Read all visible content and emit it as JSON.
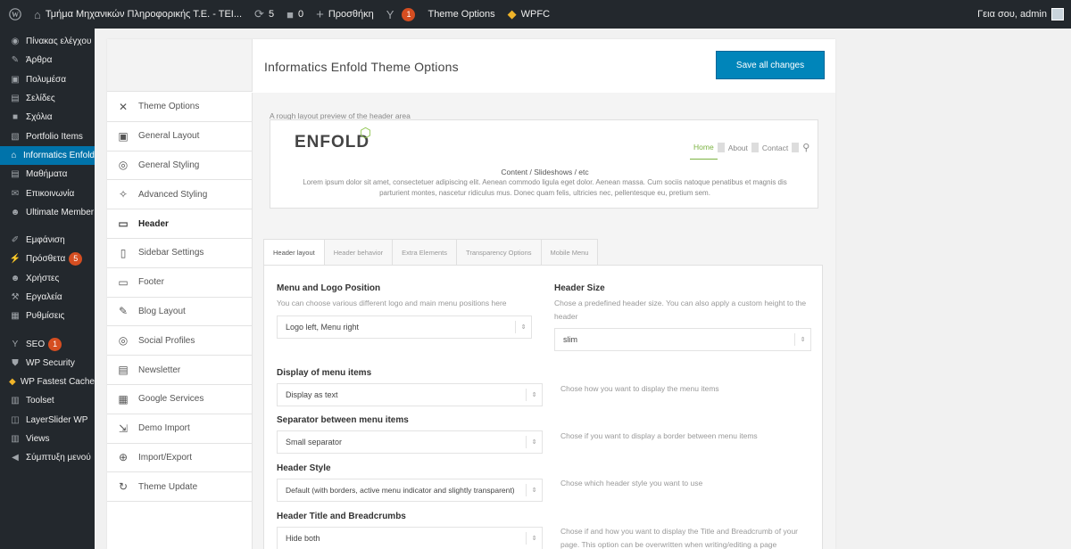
{
  "admin_bar": {
    "site_name": "Τμήμα Μηχανικών Πληροφορικής Τ.Ε. - ΤΕΙ...",
    "updates_count": "5",
    "comments_count": "0",
    "new_label": "Προσθήκη",
    "yoast_badge": "1",
    "theme_options_label": "Theme Options",
    "wpfc_label": "WPFC",
    "greeting": "Γεια σου, admin"
  },
  "sidebar": {
    "items": [
      {
        "label": "Πίνακας ελέγχου",
        "icon": "dashboard-icon"
      },
      {
        "label": "Άρθρα",
        "icon": "pin-icon"
      },
      {
        "label": "Πολυμέσα",
        "icon": "media-icon"
      },
      {
        "label": "Σελίδες",
        "icon": "page-icon"
      },
      {
        "label": "Σχόλια",
        "icon": "comment-icon"
      },
      {
        "label": "Portfolio Items",
        "icon": "portfolio-icon"
      },
      {
        "label": "Informatics Enfold",
        "icon": "home-icon"
      },
      {
        "label": "Μαθήματα",
        "icon": "page-icon"
      },
      {
        "label": "Επικοινωνία",
        "icon": "mail-icon"
      },
      {
        "label": "Ultimate Member",
        "icon": "user-icon"
      },
      {
        "label": "Εμφάνιση",
        "icon": "brush-icon"
      },
      {
        "label": "Πρόσθετα",
        "icon": "plugin-icon",
        "badge": "5"
      },
      {
        "label": "Χρήστες",
        "icon": "user-icon"
      },
      {
        "label": "Εργαλεία",
        "icon": "wrench-icon"
      },
      {
        "label": "Ρυθμίσεις",
        "icon": "settings-icon"
      },
      {
        "label": "SEO",
        "icon": "yoast-icon",
        "badge": "1"
      },
      {
        "label": "WP Security",
        "icon": "shield-icon"
      },
      {
        "label": "WP Fastest Cache",
        "icon": "cheetah-icon"
      },
      {
        "label": "Toolset",
        "icon": "toolset-icon"
      },
      {
        "label": "LayerSlider WP",
        "icon": "layers-icon"
      },
      {
        "label": "Views",
        "icon": "views-icon"
      },
      {
        "label": "Σύμπτυξη μενού",
        "icon": "collapse-icon"
      }
    ]
  },
  "page": {
    "title": "Informatics Enfold Theme Options",
    "save_label": "Save all changes"
  },
  "options_nav": [
    {
      "label": "Theme Options",
      "icon": "tools-icon"
    },
    {
      "label": "General Layout",
      "icon": "layout-icon"
    },
    {
      "label": "General Styling",
      "icon": "palette-icon"
    },
    {
      "label": "Advanced Styling",
      "icon": "magic-wand-icon"
    },
    {
      "label": "Header",
      "icon": "header-icon"
    },
    {
      "label": "Sidebar Settings",
      "icon": "sidebar-icon"
    },
    {
      "label": "Footer",
      "icon": "footer-icon"
    },
    {
      "label": "Blog Layout",
      "icon": "edit-icon"
    },
    {
      "label": "Social Profiles",
      "icon": "social-icon"
    },
    {
      "label": "Newsletter",
      "icon": "newsletter-icon"
    },
    {
      "label": "Google Services",
      "icon": "map-icon"
    },
    {
      "label": "Demo Import",
      "icon": "import-icon"
    },
    {
      "label": "Import/Export",
      "icon": "export-icon"
    },
    {
      "label": "Theme Update",
      "icon": "refresh-icon"
    }
  ],
  "preview": {
    "caption": "A rough layout preview of the header area",
    "logo": "ENFOLD",
    "menu": [
      "Home",
      "About",
      "Contact"
    ],
    "content_title": "Content / Slideshows / etc",
    "content_text": "Lorem ipsum dolor sit amet, consectetuer adipiscing elit. Aenean commodo ligula eget dolor. Aenean massa. Cum sociis natoque penatibus et magnis dis parturient montes, nascetur ridiculus mus. Donec quam felis, ultricies nec, pellentesque eu, pretium sem."
  },
  "tabs": [
    "Header layout",
    "Header behavior",
    "Extra Elements",
    "Transparency Options",
    "Mobile Menu"
  ],
  "fields": {
    "menu_logo": {
      "title": "Menu and Logo Position",
      "desc": "You can choose various different logo and main menu positions here",
      "value": "Logo left, Menu right"
    },
    "header_size": {
      "title": "Header Size",
      "desc": "Chose a predefined header size. You can also apply a custom height to the header",
      "value": "slim"
    },
    "menu_items": {
      "title": "Display of menu items",
      "value": "Display as text",
      "desc": "Chose how you want to display the menu items"
    },
    "separator": {
      "title": "Separator between menu items",
      "value": "Small separator",
      "desc": "Chose if you want to display a border between menu items"
    },
    "header_style": {
      "title": "Header Style",
      "value": "Default (with borders, active menu indicator and slightly transparent)",
      "desc": "Chose which header style you want to use"
    },
    "title_breadcrumbs": {
      "title": "Header Title and Breadcrumbs",
      "value": "Hide both",
      "desc": "Chose if and how you want to display the Title and Breadcrumb of your page. This option can be overwritten when writing/editing a page"
    }
  },
  "colors": {
    "accent": "#0073aa",
    "save_button": "#0085ba",
    "preview_green": "#7cb342",
    "adminbar": "#23282d"
  }
}
